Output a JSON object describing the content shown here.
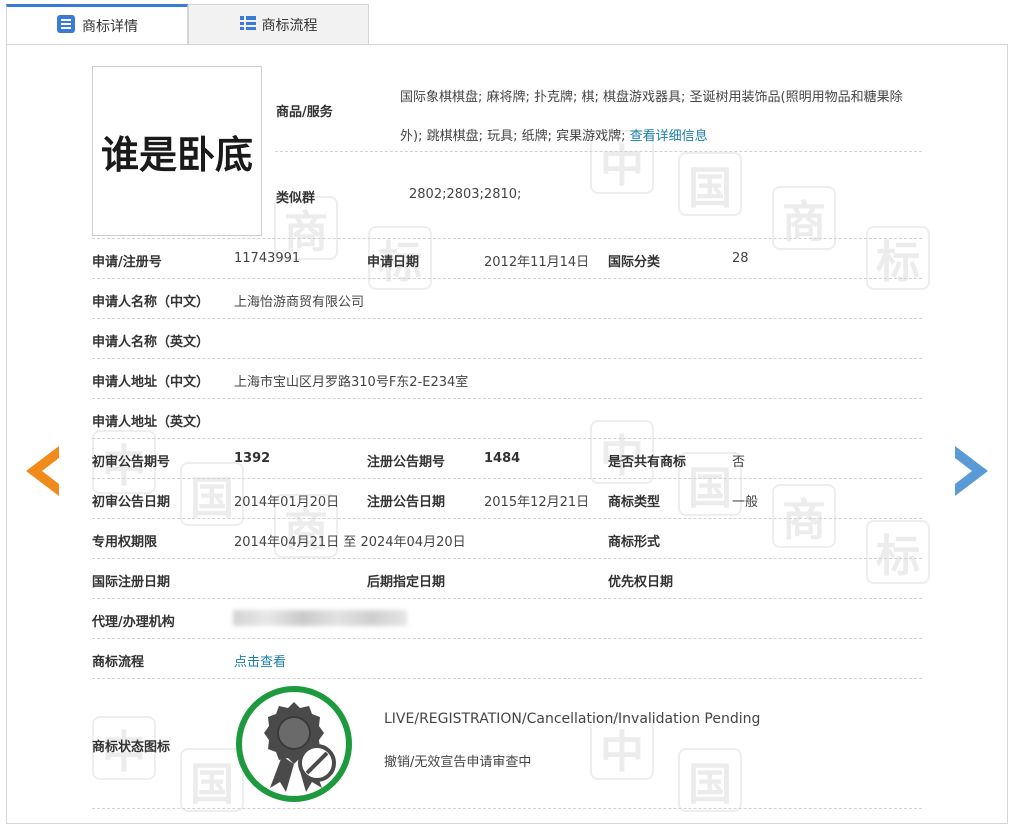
{
  "tabs": [
    {
      "label": "商标详情",
      "icon": "document-list-icon",
      "active": true
    },
    {
      "label": "商标流程",
      "icon": "grid-table-icon",
      "active": false
    }
  ],
  "watermark": [
    "中",
    "国",
    "商",
    "标"
  ],
  "trademark": {
    "logo_text": "谁是卧底"
  },
  "goods": {
    "label": "商品/服务",
    "text": "国际象棋棋盘; 麻将牌; 扑克牌; 棋; 棋盘游戏器具; 圣诞树用装饰品(照明用物品和糖果除外); 跳棋棋盘; 玩具; 纸牌; 宾果游戏牌;",
    "link": "查看详细信息"
  },
  "similar_group": {
    "label": "类似群",
    "value": "2802;2803;2810;"
  },
  "fields": {
    "reg_no_label": "申请/注册号",
    "reg_no": "11743991",
    "apply_date_label": "申请日期",
    "apply_date": "2012年11月14日",
    "intl_class_label": "国际分类",
    "intl_class": "28",
    "applicant_cn_label": "申请人名称（中文）",
    "applicant_cn": "上海怡游商贸有限公司",
    "applicant_en_label": "申请人名称（英文）",
    "applicant_en": "",
    "address_cn_label": "申请人地址（中文）",
    "address_cn": "上海市宝山区月罗路310号F东2-E234室",
    "address_en_label": "申请人地址（英文）",
    "address_en": "",
    "prelim_no_label": "初审公告期号",
    "prelim_no": "1392",
    "reg_pub_no_label": "注册公告期号",
    "reg_pub_no": "1484",
    "shared_label": "是否共有商标",
    "shared": "否",
    "prelim_date_label": "初审公告日期",
    "prelim_date": "2014年01月20日",
    "reg_pub_date_label": "注册公告日期",
    "reg_pub_date": "2015年12月21日",
    "tm_type_label": "商标类型",
    "tm_type": "一般",
    "exclusive_label": "专用权期限",
    "exclusive_from": "2014年04月21日",
    "exclusive_to_word": "至",
    "exclusive_to": "2024年04月20日",
    "tm_form_label": "商标形式",
    "tm_form": "",
    "intl_reg_date_label": "国际注册日期",
    "intl_reg_date": "",
    "later_date_label": "后期指定日期",
    "later_date": "",
    "priority_date_label": "优先权日期",
    "priority_date": "",
    "agent_label": "代理/办理机构",
    "flow_label": "商标流程",
    "flow_link": "点击查看",
    "status_label": "商标状态图标",
    "status_en": "LIVE/REGISTRATION/Cancellation/Invalidation Pending",
    "status_cn": "撤销/无效宣告申请审查中"
  },
  "colors": {
    "accent_blue": "#3b7bd8",
    "link": "#1a7fa8",
    "status_green": "#1e9a3e",
    "prev_arrow": "#f08a1a",
    "next_arrow": "#5b9bd5"
  }
}
